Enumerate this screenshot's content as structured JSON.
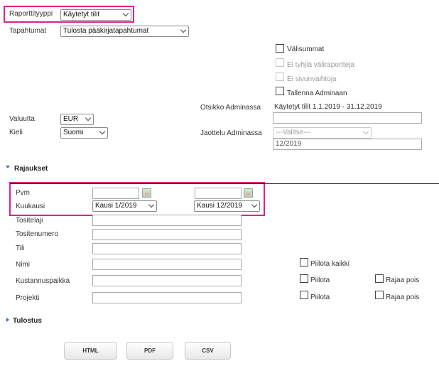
{
  "fields": {
    "report_type": {
      "label": "Raporttityyppi",
      "value": "Käytetyt tilit"
    },
    "events": {
      "label": "Tapahtumat",
      "value": "Tulosta pääkirjatapahtumat"
    },
    "currency": {
      "label": "Valuutta",
      "value": "EUR"
    },
    "language": {
      "label": "Kieli",
      "value": "Suomi"
    },
    "admin_title": {
      "label": "Otsikko Adminassa",
      "value": "Käytetyt tilit 1.1.2019 - 31.12.2019"
    },
    "admin_split": {
      "label": "Jaottelu Adminassa",
      "value": "---Valitse---"
    },
    "period_field": {
      "value": "12/2019"
    }
  },
  "options": {
    "subtotals": "Välisummat",
    "no_empty_subreports": "Ei tyhjiä väliraportteja",
    "no_page_breaks": "Ei sivunvaihtoja",
    "save_admin": "Tallenna Adminaan"
  },
  "restrictions": {
    "title": "Rajaukset",
    "date_label": "Pvm",
    "month_label": "Kuukausi",
    "month_from": "Kausi 1/2019",
    "month_to": "Kausi 12/2019",
    "voucher_type": "Tositelaji",
    "voucher_number": "Tositenumero",
    "account": "Tili",
    "name": "Nimi",
    "cost_center": "Kustannuspaikka",
    "project": "Projekti",
    "hide_all": "Piilota kaikki",
    "hide": "Piilota",
    "limit_out": "Rajaa pois"
  },
  "output": {
    "title": "Tulostus",
    "html": "HTML",
    "pdf": "PDF",
    "csv": "CSV"
  }
}
